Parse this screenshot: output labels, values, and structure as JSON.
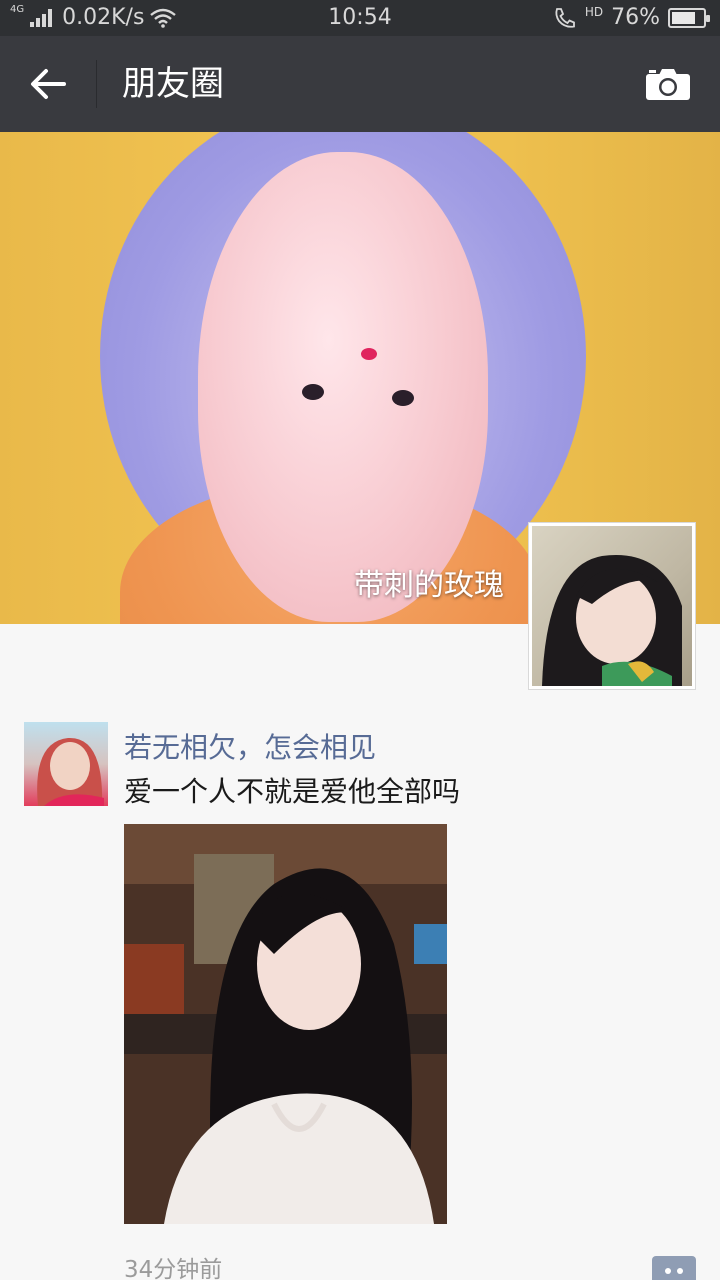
{
  "status_bar": {
    "network": "4G",
    "speed": "0.02K/s",
    "time": "10:54",
    "hd": "HD",
    "battery": "76%",
    "battery_level": 0.76
  },
  "nav": {
    "title": "朋友圈",
    "back_icon": "arrow-left-icon",
    "camera_icon": "camera-icon"
  },
  "cover": {
    "display_name": "带刺的玫瑰"
  },
  "post": {
    "author": "若无相欠，怎会相见",
    "text": "爱一个人不就是爱他全部吗",
    "time": "34分钟前",
    "comment_icon": "comment-dots-icon"
  },
  "colors": {
    "nav_bg": "#393a3f",
    "status_bg": "#2e3033",
    "author_link": "#576b95",
    "page_bg": "#f7f7f7"
  }
}
